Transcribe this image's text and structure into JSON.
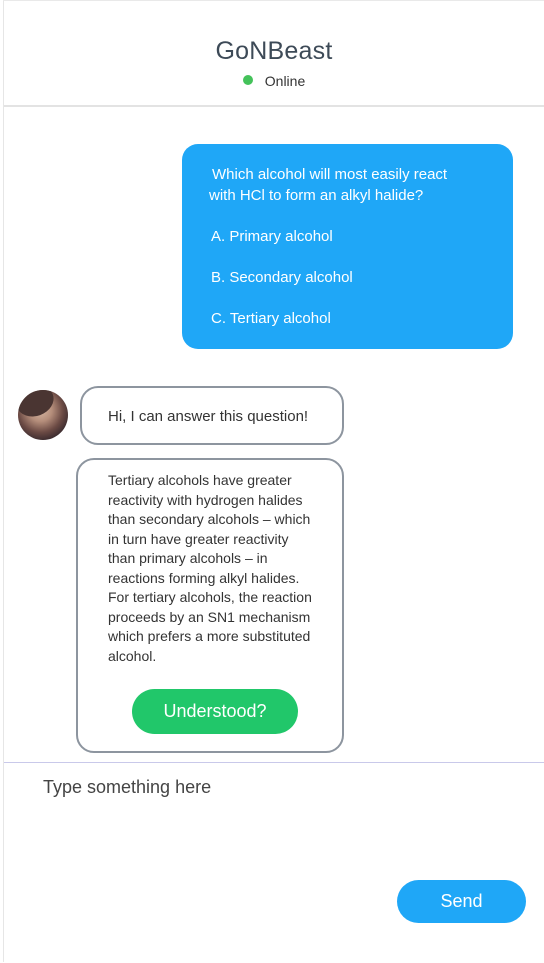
{
  "header": {
    "title": "GoNBeast",
    "status": "Online",
    "status_color": "#44c25a"
  },
  "messages": {
    "user": {
      "question_line1": "Which alcohol will most easily react",
      "question_line2": "with HCl to form an alkyl halide?",
      "options": [
        "A. Primary alcohol",
        "B. Secondary alcohol",
        "C. Tertiary alcohol"
      ]
    },
    "bot_greeting": "Hi, I can answer this question!",
    "bot_answer_lines": [
      "Tertiary alcohols have greater",
      "reactivity with hydrogen halides",
      "than secondary alcohols – which",
      "in turn have greater reactivity",
      "than primary alcohols – in",
      "reactions forming alkyl halides.",
      "For tertiary alcohols, the reaction",
      "proceeds by an SN1 mechanism",
      "which prefers a more substituted",
      "alcohol."
    ],
    "understood_label": "Understood?"
  },
  "composer": {
    "placeholder": "Type something here",
    "send_label": "Send"
  },
  "colors": {
    "user_bubble": "#1fa7f7",
    "understood_button": "#21c76a",
    "send_button": "#1fa7f7"
  }
}
